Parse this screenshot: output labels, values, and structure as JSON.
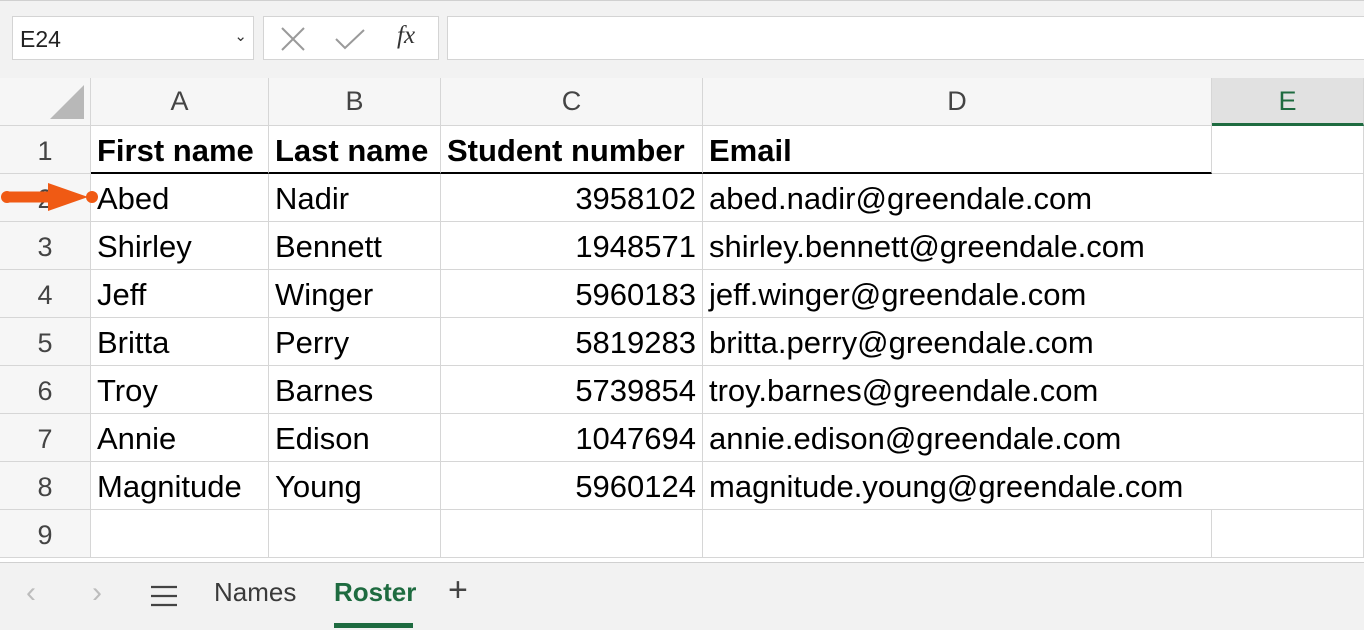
{
  "formula_bar": {
    "name_box": "E24",
    "name_box_dropdown": "⌄",
    "cancel_icon": "x-icon",
    "enter_icon": "check-icon",
    "fx_label": "fx",
    "formula_value": ""
  },
  "columns": [
    "A",
    "B",
    "C",
    "D",
    "E"
  ],
  "selected_column": "E",
  "rows": [
    "1",
    "2",
    "3",
    "4",
    "5",
    "6",
    "7",
    "8",
    "9"
  ],
  "sheet": {
    "headers": [
      "First name",
      "Last name",
      "Student number",
      "Email"
    ],
    "records": [
      [
        "Abed",
        "Nadir",
        "3958102",
        "abed.nadir@greendale.com"
      ],
      [
        "Shirley",
        "Bennett",
        "1948571",
        "shirley.bennett@greendale.com"
      ],
      [
        "Jeff",
        "Winger",
        "5960183",
        "jeff.winger@greendale.com"
      ],
      [
        "Britta",
        "Perry",
        "5819283",
        "britta.perry@greendale.com"
      ],
      [
        "Troy",
        "Barnes",
        "5739854",
        "troy.barnes@greendale.com"
      ],
      [
        "Annie",
        "Edison",
        "1047694",
        "annie.edison@greendale.com"
      ],
      [
        "Magnitude",
        "Young",
        "5960124",
        "magnitude.young@greendale.com"
      ]
    ]
  },
  "annotation": {
    "icon": "arrow-right-icon",
    "color": "#f05a14"
  },
  "tabs": {
    "prev_icon": "‹",
    "next_icon": "›",
    "menu_icon": "hamburger-icon",
    "sheets": [
      {
        "label": "Names",
        "active": false
      },
      {
        "label": "Roster",
        "active": true
      }
    ],
    "add_label": "+"
  },
  "colors": {
    "accent": "#1e6b40",
    "grid_line": "#d6d6d6",
    "header_bg": "#f6f6f6"
  }
}
